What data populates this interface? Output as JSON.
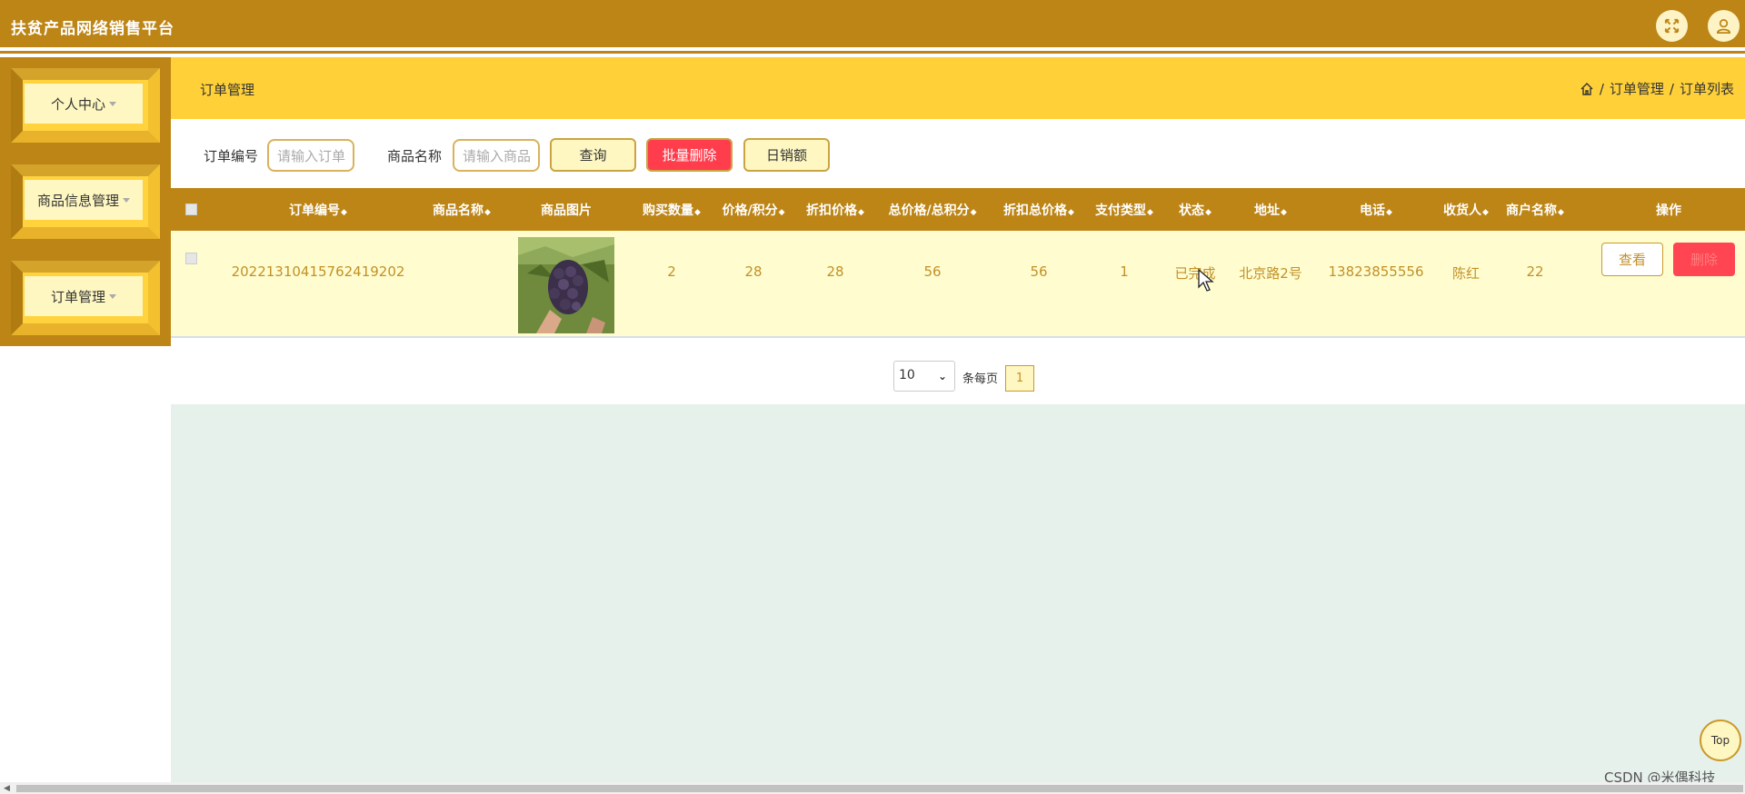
{
  "app": {
    "title": "扶贫产品网络销售平台"
  },
  "topbar": {
    "icons": [
      "fullscreen-icon",
      "user-icon"
    ]
  },
  "sidebar": {
    "items": [
      {
        "label": "个人中心"
      },
      {
        "label": "商品信息管理"
      },
      {
        "label": "订单管理"
      }
    ]
  },
  "header": {
    "title": "订单管理",
    "breadcrumb": {
      "sep1": "/",
      "item1": "订单管理",
      "sep2": "/",
      "item2": "订单列表"
    }
  },
  "search": {
    "order_no_label": "订单编号",
    "order_no_placeholder": "请输入订单",
    "product_label": "商品名称",
    "product_placeholder": "请输入商品",
    "query_label": "查询",
    "batch_delete_label": "批量删除",
    "daily_sales_label": "日销额"
  },
  "table": {
    "columns": [
      "订单编号",
      "商品名称",
      "商品图片",
      "购买数量",
      "价格/积分",
      "折扣价格",
      "总价格/总积分",
      "折扣总价格",
      "支付类型",
      "状态",
      "地址",
      "电话",
      "收货人",
      "商户名称",
      "操作"
    ],
    "sort_glyph": "◆",
    "rows": [
      {
        "order_no": "20221310415762419202",
        "product_name": "",
        "quantity": "2",
        "price": "28",
        "discount_price": "28",
        "total": "56",
        "discount_total": "56",
        "pay_type": "1",
        "status": "已完成",
        "address": "北京路2号",
        "phone": "13823855556",
        "receiver": "陈红",
        "merchant": "22",
        "view_label": "查看",
        "delete_label": "删除"
      }
    ]
  },
  "pager": {
    "page_size": "10",
    "per_page_label": "条每页",
    "current_page": "1"
  },
  "to_top_label": "Top",
  "watermark": "CSDN @米偶科技",
  "colors": {
    "primary": "#bd8516",
    "accent": "#ffd038",
    "row_bg": "#fffdd0",
    "danger": "#ff3d4d"
  }
}
